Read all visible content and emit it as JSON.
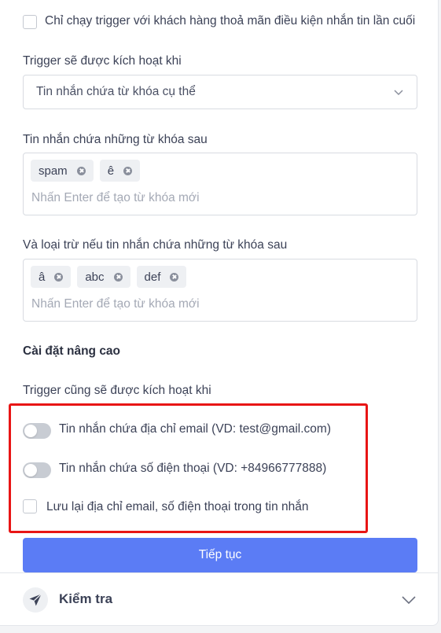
{
  "last_message_checkbox": {
    "label": "Chỉ chạy trigger với khách hàng thoả mãn điều kiện nhắn tin lần cuối",
    "checked": false
  },
  "trigger_condition": {
    "label": "Trigger sẽ được kích hoạt khi",
    "selected": "Tin nhắn chứa từ khóa cụ thể"
  },
  "include_keywords": {
    "label": "Tin nhắn chứa những từ khóa sau",
    "tags": [
      "spam",
      "ê"
    ],
    "placeholder": "Nhấn Enter để tạo từ khóa mới"
  },
  "exclude_keywords": {
    "label": "Và loại trừ nếu tin nhắn chứa những từ khóa sau",
    "tags": [
      "â",
      "abc",
      "def"
    ],
    "placeholder": "Nhấn Enter để tạo từ khóa mới"
  },
  "advanced": {
    "heading": "Cài đặt nâng cao",
    "subheading": "Trigger cũng sẽ được kích hoạt khi",
    "email_toggle": {
      "label": "Tin nhắn chứa địa chỉ email (VD: test@gmail.com)",
      "on": false
    },
    "phone_toggle": {
      "label": "Tin nhắn chứa số điện thoại (VD: +84966777888)",
      "on": false
    },
    "save_checkbox": {
      "label": "Lưu lại địa chỉ email, số điện thoại trong tin nhắn",
      "checked": false
    }
  },
  "continue_button": {
    "label": "Tiếp tục"
  },
  "test_section": {
    "label": "Kiểm tra",
    "icon": "send-icon"
  },
  "colors": {
    "primary": "#5b7cf5",
    "highlight": "#e81515",
    "toggle_off": "#c8ccd3"
  }
}
